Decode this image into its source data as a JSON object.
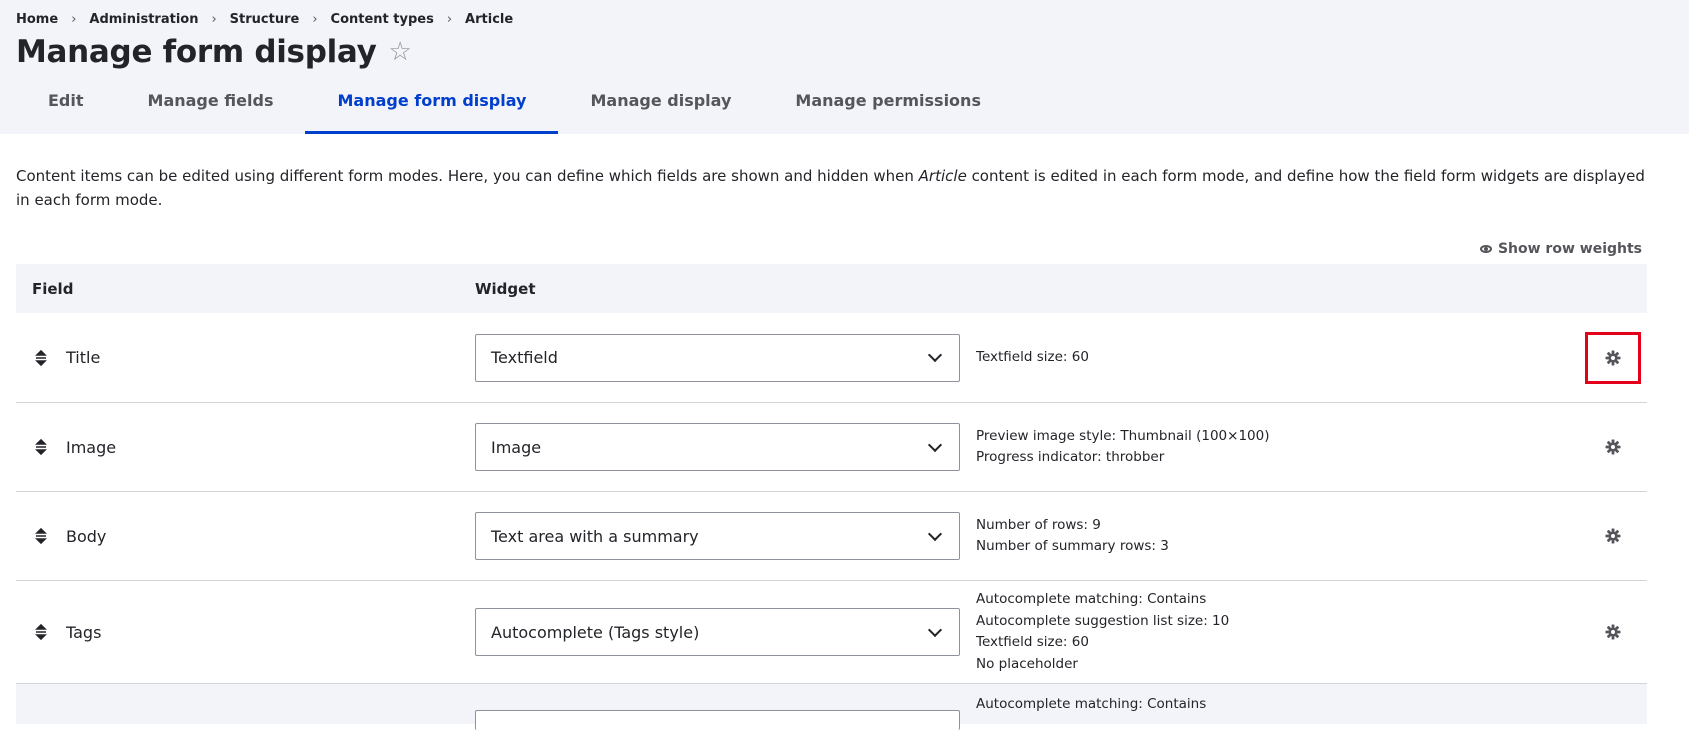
{
  "breadcrumb": [
    "Home",
    "Administration",
    "Structure",
    "Content types",
    "Article"
  ],
  "page_title": "Manage form display",
  "tabs": [
    "Edit",
    "Manage fields",
    "Manage form display",
    "Manage display",
    "Manage permissions"
  ],
  "active_tab": "Manage form display",
  "description": {
    "before": "Content items can be edited using different form modes. Here, you can define which fields are shown and hidden when ",
    "emphasis": "Article",
    "after": " content is edited in each form mode, and define how the field form widgets are displayed in each form mode."
  },
  "show_row_weights": "Show row weights",
  "table": {
    "headers": [
      "Field",
      "Widget"
    ],
    "rows": [
      {
        "field": "Title",
        "widget": "Textfield",
        "summary": [
          "Textfield size: 60"
        ]
      },
      {
        "field": "Image",
        "widget": "Image",
        "summary": [
          "Preview image style: Thumbnail (100×100)",
          "Progress indicator: throbber"
        ]
      },
      {
        "field": "Body",
        "widget": "Text area with a summary",
        "summary": [
          "Number of rows: 9",
          "Number of summary rows: 3"
        ]
      },
      {
        "field": "Tags",
        "widget": "Autocomplete (Tags style)",
        "summary": [
          "Autocomplete matching: Contains",
          "Autocomplete suggestion list size: 10",
          "Textfield size: 60",
          "No placeholder"
        ]
      },
      {
        "field": "",
        "widget": "",
        "summary": [
          "Autocomplete matching: Contains"
        ]
      }
    ]
  },
  "colors": {
    "accent": "#003ecc",
    "highlight": "#e4001b",
    "header_bg": "#f3f4f9"
  },
  "icons": {
    "settings": "gear-icon",
    "drag": "drag-handle-icon",
    "favorite": "star-icon"
  }
}
